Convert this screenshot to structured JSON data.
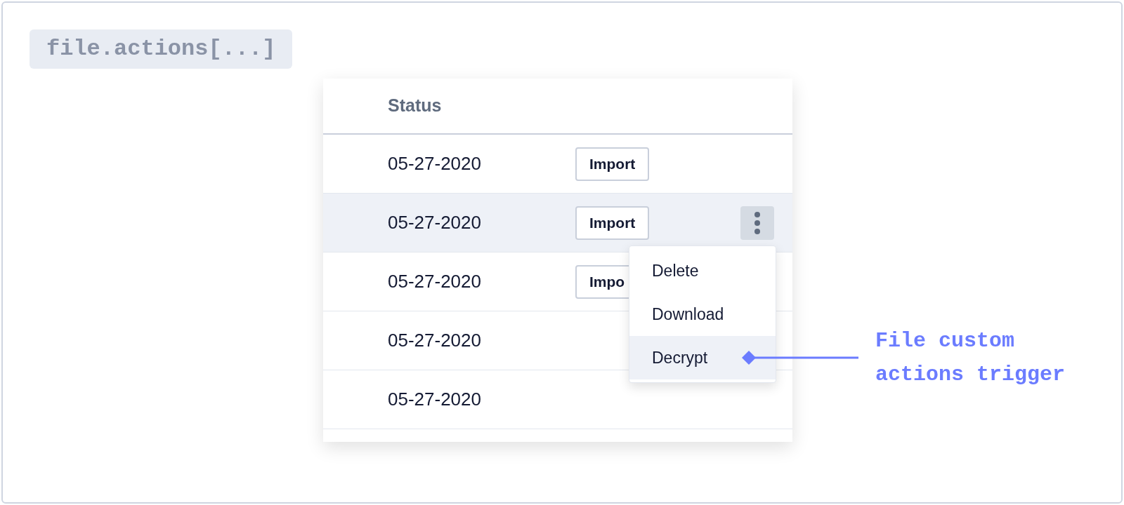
{
  "code_tag": "file.actions[...]",
  "table": {
    "columns": [
      "Status"
    ],
    "rows": [
      {
        "date": "05-27-2020",
        "action": "Import",
        "selected": false
      },
      {
        "date": "05-27-2020",
        "action": "Import",
        "selected": true,
        "menu": {
          "items": [
            {
              "label": "Delete",
              "selected": false
            },
            {
              "label": "Download",
              "selected": false
            },
            {
              "label": "Decrypt",
              "selected": true
            }
          ]
        }
      },
      {
        "date": "05-27-2020",
        "action": "Impo",
        "selected": false
      },
      {
        "date": "05-27-2020",
        "selected": false
      },
      {
        "date": "05-27-2020",
        "selected": false
      }
    ]
  },
  "callout": {
    "text": "File custom actions trigger"
  }
}
